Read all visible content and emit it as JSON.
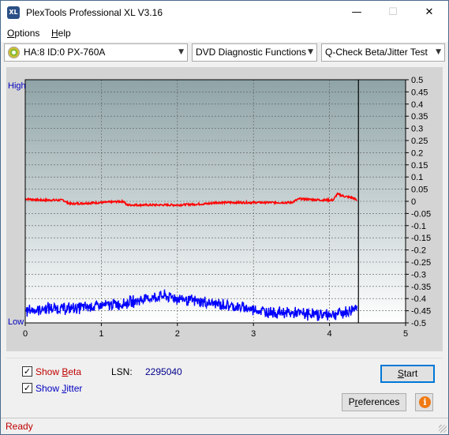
{
  "window": {
    "title": "PlexTools Professional XL V3.16",
    "icon_text": "XL",
    "controls": {
      "minimize": "—",
      "maximize": "☐",
      "close": "✕"
    }
  },
  "menu": {
    "options": {
      "accel": "O",
      "rest": "ptions"
    },
    "help": {
      "accel": "H",
      "rest": "elp"
    }
  },
  "toolbar": {
    "drive": "HA:8 ID:0  PX-760A",
    "function": "DVD Diagnostic Functions",
    "test": "Q-Check Beta/Jitter Test"
  },
  "chart_data": {
    "type": "line",
    "x_ticks": [
      "0",
      "1",
      "2",
      "3",
      "4",
      "5"
    ],
    "xlim": [
      0,
      5
    ],
    "y_left_labels": {
      "top": "High",
      "bottom": "Low"
    },
    "y_right_ticks": [
      "0.5",
      "0.45",
      "0.4",
      "0.35",
      "0.3",
      "0.25",
      "0.2",
      "0.15",
      "0.1",
      "0.05",
      "0",
      "-0.05",
      "-0.1",
      "-0.15",
      "-0.2",
      "-0.25",
      "-0.3",
      "-0.35",
      "-0.4",
      "-0.45",
      "-0.5"
    ],
    "ylim": [
      -0.5,
      0.5
    ],
    "grid": true,
    "end_marker_x": 4.38,
    "series": [
      {
        "color": "#ff0000",
        "x": [
          0,
          0.2,
          0.5,
          0.55,
          0.6,
          1.0,
          1.3,
          1.33,
          1.6,
          2.0,
          2.4,
          2.5,
          3.0,
          3.5,
          3.6,
          3.9,
          4.05,
          4.1,
          4.2,
          4.3,
          4.36
        ],
        "y": [
          0.01,
          0.005,
          0.005,
          -0.005,
          -0.01,
          -0.005,
          0.0,
          -0.015,
          -0.015,
          -0.015,
          -0.01,
          -0.005,
          -0.005,
          -0.005,
          0.01,
          0.005,
          0.005,
          0.03,
          0.02,
          0.015,
          0.005
        ]
      },
      {
        "color": "#0000ff",
        "x": [
          0,
          0.3,
          0.6,
          1.0,
          1.3,
          1.6,
          1.8,
          1.95,
          2.2,
          2.6,
          2.9,
          3.2,
          3.5,
          3.8,
          4.0,
          4.1,
          4.25,
          4.36
        ],
        "y": [
          -0.45,
          -0.44,
          -0.44,
          -0.43,
          -0.42,
          -0.4,
          -0.39,
          -0.395,
          -0.41,
          -0.425,
          -0.44,
          -0.455,
          -0.46,
          -0.465,
          -0.465,
          -0.46,
          -0.455,
          -0.43
        ]
      }
    ]
  },
  "options": {
    "show_beta": {
      "checked": true,
      "pre": "Show ",
      "accel": "B",
      "rest": "eta"
    },
    "show_jitter": {
      "checked": true,
      "pre": "Show ",
      "accel": "J",
      "rest": "itter"
    },
    "check_mark": "✓"
  },
  "lsn": {
    "label": "LSN:",
    "value": "2295040"
  },
  "buttons": {
    "start": {
      "accel": "S",
      "rest": "tart"
    },
    "preferences": {
      "pre": "P",
      "accel": "r",
      "rest": "eferences"
    },
    "info_glyph": "i"
  },
  "status": {
    "text": "Ready"
  }
}
